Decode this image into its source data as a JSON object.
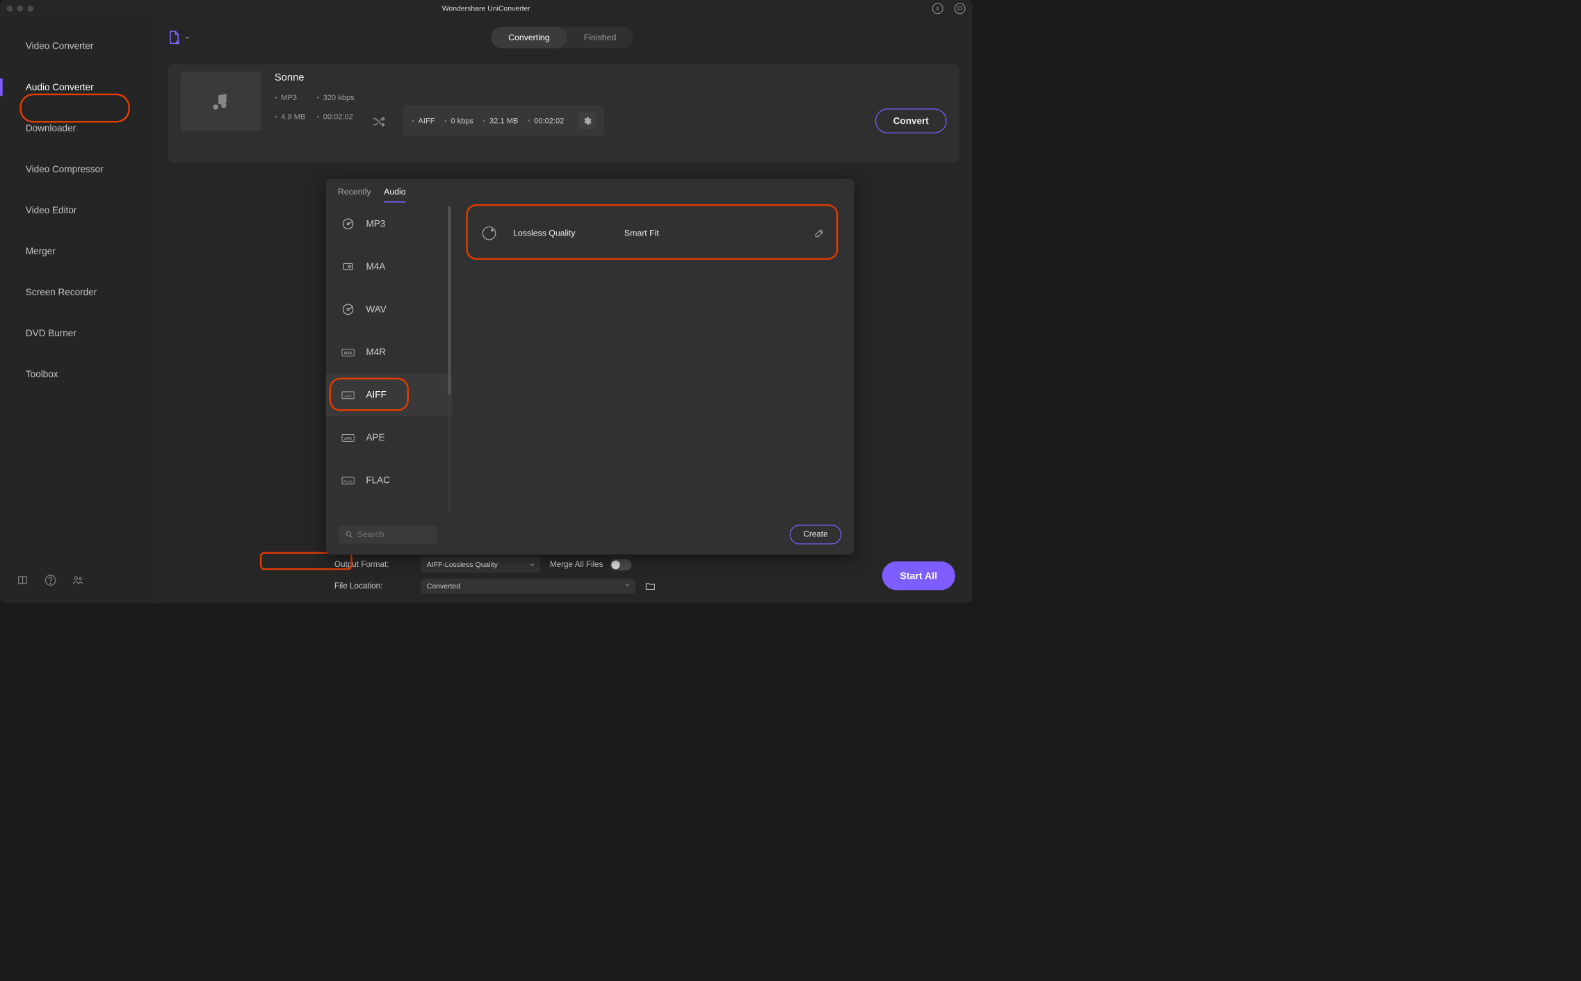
{
  "titlebar": {
    "title": "Wondershare UniConverter"
  },
  "sidebar": {
    "items": [
      {
        "label": "Video Converter"
      },
      {
        "label": "Audio Converter"
      },
      {
        "label": "Downloader"
      },
      {
        "label": "Video Compressor"
      },
      {
        "label": "Video Editor"
      },
      {
        "label": "Merger"
      },
      {
        "label": "Screen Recorder"
      },
      {
        "label": "DVD Burner"
      },
      {
        "label": "Toolbox"
      }
    ],
    "active_index": 1
  },
  "segmented": {
    "items": [
      {
        "label": "Converting"
      },
      {
        "label": "Finished"
      }
    ],
    "active_index": 0
  },
  "file": {
    "name": "Sonne",
    "src_format": "MP3",
    "src_bitrate": "320 kbps",
    "src_size": "4.9 MB",
    "src_duration": "00:02:02",
    "out_format": "AIFF",
    "out_bitrate": "0 kbps",
    "out_size": "32.1 MB",
    "out_duration": "00:02:02",
    "convert_btn": "Convert"
  },
  "popover": {
    "tabs": [
      {
        "label": "Recently"
      },
      {
        "label": "Audio"
      }
    ],
    "active_tab_index": 1,
    "formats": [
      {
        "label": "MP3"
      },
      {
        "label": "M4A"
      },
      {
        "label": "WAV"
      },
      {
        "label": "M4R"
      },
      {
        "label": "AIFF"
      },
      {
        "label": "APE"
      },
      {
        "label": "FLAC"
      }
    ],
    "selected_format_index": 4,
    "preset": {
      "quality": "Lossless Quality",
      "fit": "Smart Fit"
    },
    "search_placeholder": "Search",
    "create_btn": "Create"
  },
  "bottombar": {
    "output_format_label": "Output Format:",
    "output_format_value": "AIFF-Lossless Quality",
    "merge_label": "Merge All Files",
    "file_location_label": "File Location:",
    "file_location_value": "Converted",
    "start_all": "Start All"
  },
  "colors": {
    "accent": "#7d5dff",
    "highlight": "#e23c00"
  }
}
